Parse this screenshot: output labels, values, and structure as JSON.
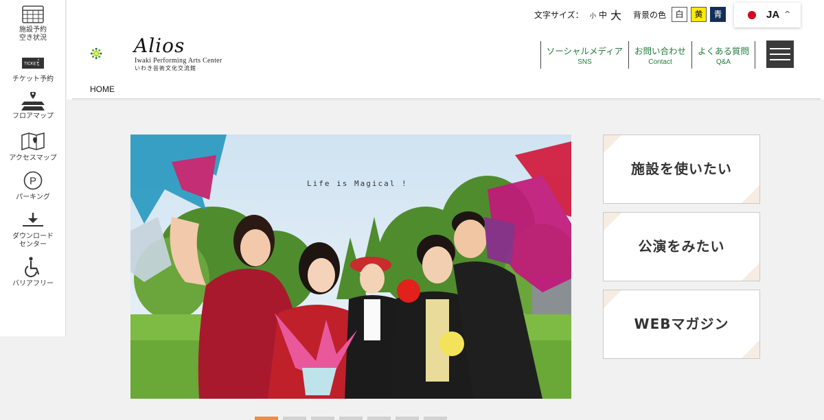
{
  "sidebar": {
    "items": [
      {
        "icon": "calendar-grid-icon",
        "label": "施設予約\n空き状況"
      },
      {
        "icon": "ticket-icon",
        "label": "チケット予約",
        "icon_text": "TICKET"
      },
      {
        "icon": "floor-map-icon",
        "label": "フロアマップ"
      },
      {
        "icon": "access-map-icon",
        "label": "アクセスマップ"
      },
      {
        "icon": "parking-icon",
        "label": "パーキング",
        "icon_text": "P"
      },
      {
        "icon": "download-icon",
        "label": "ダウンロード\nセンター"
      },
      {
        "icon": "wheelchair-icon",
        "label": "バリアフリー"
      }
    ]
  },
  "logo": {
    "name": "Alios",
    "subtitle_en": "Iwaki Performing Arts Center",
    "subtitle_jp": "いわき芸術文化交流館",
    "colors": [
      "#1e7a34",
      "#5aa52c",
      "#9cc21a",
      "#c8d400"
    ]
  },
  "breadcrumb": "HOME",
  "accessibility": {
    "font_size_label": "文字サイズ：",
    "font_sizes": [
      "小",
      "中",
      "大"
    ],
    "bg_label": "背景の色",
    "bg_colors": [
      {
        "label": "白",
        "color": "#ffffff"
      },
      {
        "label": "黄",
        "color": "#ffeb00"
      },
      {
        "label": "青",
        "color": "#142f55"
      }
    ]
  },
  "language": {
    "code": "JA",
    "chevron": "^"
  },
  "nav": [
    {
      "jp": "ソーシャルメディア",
      "en": "SNS"
    },
    {
      "jp": "お問い合わせ",
      "en": "Contact"
    },
    {
      "jp": "よくある質問",
      "en": "Q&A"
    }
  ],
  "hero": {
    "tagline": "Life is Magical !"
  },
  "menu_cards": [
    {
      "label": "施設を使いたい"
    },
    {
      "label": "公演をみたい"
    },
    {
      "label": "WEBマガジン"
    }
  ],
  "slider": {
    "count": 7,
    "active_index": 0
  },
  "colors": {
    "accent_green": "#1f7a3a",
    "active_dot": "#f08a4b",
    "card_corner": "#f6ece2"
  }
}
